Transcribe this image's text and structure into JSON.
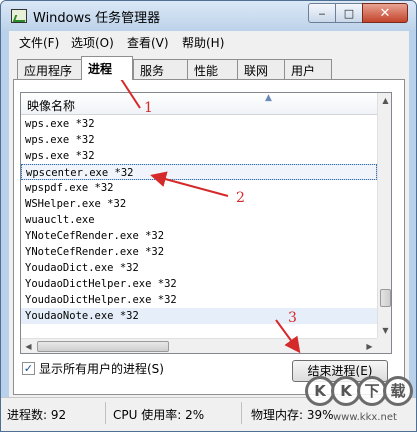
{
  "window": {
    "title": "Windows 任务管理器",
    "buttons": {
      "minimize": "‒",
      "maximize": "□",
      "close": "✕"
    }
  },
  "menu": [
    {
      "label": "文件(F)"
    },
    {
      "label": "选项(O)"
    },
    {
      "label": "查看(V)"
    },
    {
      "label": "帮助(H)"
    }
  ],
  "tabs": [
    {
      "label": "应用程序",
      "active": false
    },
    {
      "label": "进程",
      "active": true
    },
    {
      "label": "服务",
      "active": false
    },
    {
      "label": "性能",
      "active": false
    },
    {
      "label": "联网",
      "active": false
    },
    {
      "label": "用户",
      "active": false
    }
  ],
  "process_list": {
    "column_header": "映像名称",
    "rows": [
      "wps.exe *32",
      "wps.exe *32",
      "wps.exe *32",
      "wpscenter.exe *32",
      "wpspdf.exe *32",
      "WSHelper.exe *32",
      "wuauclt.exe",
      "YNoteCefRender.exe *32",
      "YNoteCefRender.exe *32",
      "YoudaoDict.exe *32",
      "YoudaoDictHelper.exe *32",
      "YoudaoDictHelper.exe *32",
      "YoudaoNote.exe *32"
    ],
    "selected_index": 3,
    "highlight_index": 12,
    "scroll_position": 0.92
  },
  "show_all_users": {
    "label": "显示所有用户的进程(S)",
    "checked": true,
    "check_glyph": "✓"
  },
  "end_process_button": "结束进程(E)",
  "status": {
    "processes": "进程数: 92",
    "cpu": "CPU 使用率: 2%",
    "memory": "物理内存: 39%"
  },
  "annotations": [
    "1",
    "2",
    "3"
  ],
  "watermark": {
    "chars": [
      "K",
      "K",
      "下",
      "载"
    ],
    "url": "www.kkx.net"
  },
  "colors": {
    "annotation_red": "#d42a2a",
    "title_bar": "#bcd2ea",
    "close_button": "#c3442b"
  }
}
